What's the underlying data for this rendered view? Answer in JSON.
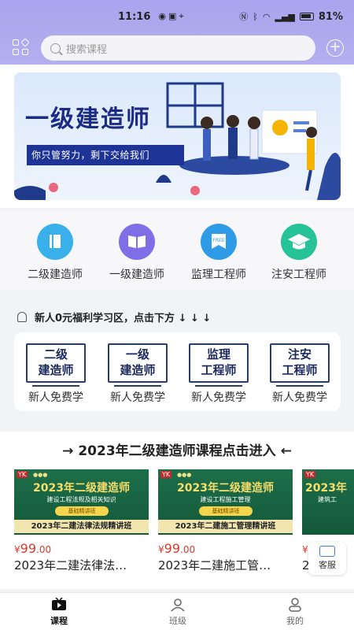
{
  "status_bar": {
    "time": "11:16",
    "battery": "81%"
  },
  "search": {
    "placeholder": "搜索课程"
  },
  "banner": {
    "title": "一级建造师",
    "subtitle": "你只管努力，剩下交给我们"
  },
  "categories": [
    {
      "label": "二级建造师",
      "icon": "book-icon",
      "color": "#39b0ea"
    },
    {
      "label": "一级建造师",
      "icon": "open-book-icon",
      "color": "#7f6ee5"
    },
    {
      "label": "监理工程师",
      "icon": "free-ribbon-icon",
      "color": "#2f9be6"
    },
    {
      "label": "注安工程师",
      "icon": "graduation-cap-icon",
      "color": "#26c398"
    }
  ],
  "promo": {
    "headline": "新人0元福利学习区，点击下方 ↓ ↓ ↓",
    "items": [
      {
        "line1": "二级",
        "line2": "建造师",
        "caption": "新人免费学"
      },
      {
        "line1": "一级",
        "line2": "建造师",
        "caption": "新人免费学"
      },
      {
        "line1": "监理",
        "line2": "工程师",
        "caption": "新人免费学"
      },
      {
        "line1": "注安",
        "line2": "工程师",
        "caption": "新人免费学"
      }
    ]
  },
  "section": {
    "title": "→ 2023年二级建造师课程点击进入 ←"
  },
  "courses": [
    {
      "thumb_title": "2023年二级建造师",
      "thumb_subject": "建设工程法规及相关知识",
      "thumb_badge": "基础精讲班",
      "thumb_bottom": "2023年二建法律法规精讲班",
      "price_symbol": "¥",
      "price_int": "99",
      "price_dec": ".00",
      "name": "2023年二建法律法…"
    },
    {
      "thumb_title": "2023年二级建造师",
      "thumb_subject": "建设工程施工管理",
      "thumb_badge": "基础精讲班",
      "thumb_bottom": "2023年二建施工管理精讲班",
      "price_symbol": "¥",
      "price_int": "99",
      "price_dec": ".00",
      "name": "2023年二建施工管…"
    },
    {
      "thumb_title": "2023年",
      "thumb_subject": "建筑工",
      "thumb_badge": "",
      "thumb_bottom": "",
      "price_symbol": "¥",
      "price_int": "99",
      "price_dec": "",
      "name": "2023年"
    }
  ],
  "service": {
    "label": "客服"
  },
  "tabs": [
    {
      "label": "课程",
      "active": true
    },
    {
      "label": "班级",
      "active": false
    },
    {
      "label": "我的",
      "active": false
    }
  ],
  "colors": {
    "header": "#aba6ee",
    "accent": "#1d3396",
    "price": "#d33a2c"
  }
}
